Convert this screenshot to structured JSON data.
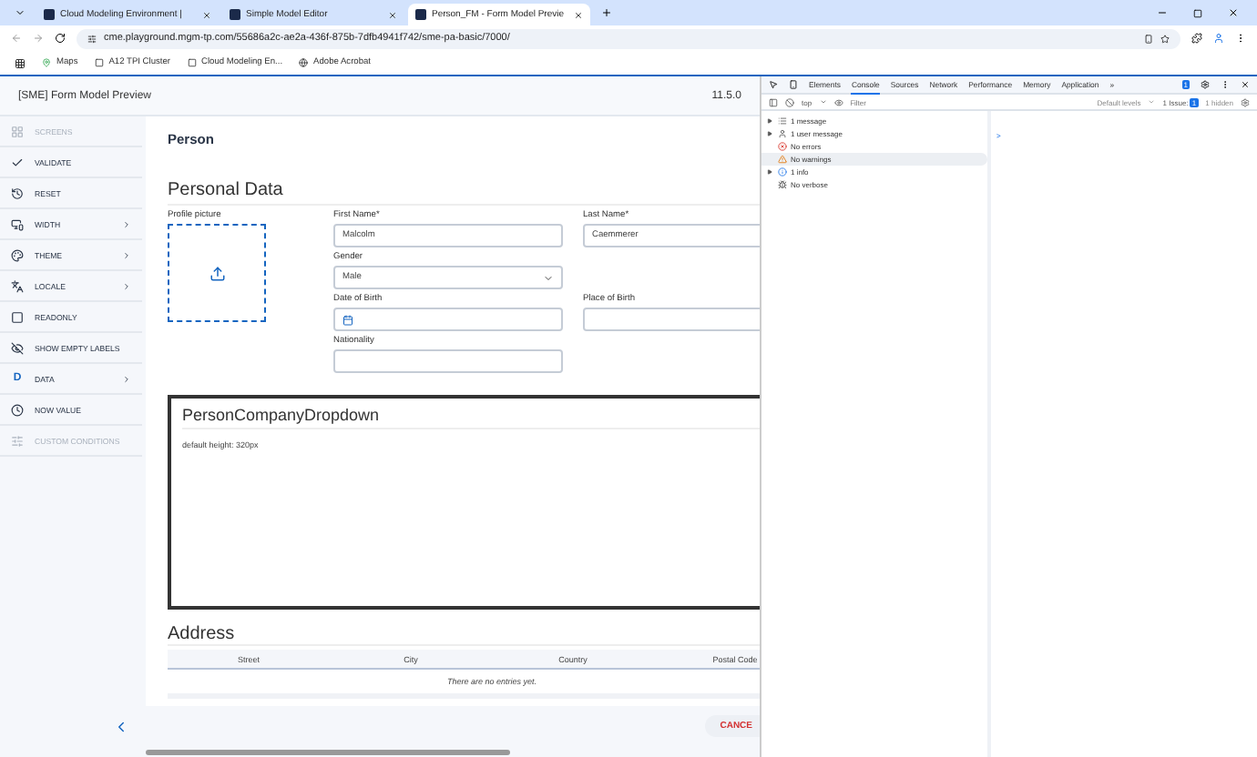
{
  "browser": {
    "tabs": [
      {
        "title": "Cloud Modeling Environment |",
        "selected": false
      },
      {
        "title": "Simple Model Editor",
        "selected": false
      },
      {
        "title": "Person_FM - Form Model Previe",
        "selected": true
      }
    ],
    "address": "cme.playground.mgm-tp.com/55686a2c-ae2a-436f-875b-7dfb4941f742/sme-pa-basic/7000/",
    "bookmarks": [
      "Maps",
      "A12 TPI Cluster",
      "Cloud Modeling En...",
      "Adobe Acrobat"
    ]
  },
  "app": {
    "title": "[SME] Form Model Preview",
    "version": "11.5.0"
  },
  "sidebar": {
    "items": [
      {
        "label": "SCREENS",
        "disabled": true,
        "submenu": false
      },
      {
        "label": "VALIDATE",
        "disabled": false,
        "submenu": false
      },
      {
        "label": "RESET",
        "disabled": false,
        "submenu": false
      },
      {
        "label": "WIDTH",
        "disabled": false,
        "submenu": true
      },
      {
        "label": "THEME",
        "disabled": false,
        "submenu": true
      },
      {
        "label": "LOCALE",
        "disabled": false,
        "submenu": true
      },
      {
        "label": "READONLY",
        "disabled": false,
        "submenu": false
      },
      {
        "label": "SHOW EMPTY LABELS",
        "disabled": false,
        "submenu": false
      },
      {
        "label": "DATA",
        "glyph": "D",
        "disabled": false,
        "submenu": true
      },
      {
        "label": "NOW VALUE",
        "disabled": false,
        "submenu": false
      },
      {
        "label": "CUSTOM CONDITIONS",
        "disabled": true,
        "submenu": false
      }
    ]
  },
  "form": {
    "title": "Person",
    "section": "Personal Data",
    "profile_label": "Profile picture",
    "rows": [
      [
        {
          "label": "First Name*",
          "kind": "text",
          "value": "Malcolm"
        },
        {
          "label": "Last Name*",
          "kind": "text",
          "value": "Caemmerer"
        }
      ],
      [
        {
          "label": "Gender",
          "kind": "select",
          "value": "Male"
        }
      ],
      [
        {
          "label": "Date of Birth",
          "kind": "date"
        },
        {
          "label": "Place of Birth",
          "kind": "text"
        }
      ],
      [
        {
          "label": "Nationality",
          "kind": "text"
        }
      ]
    ],
    "dropdown": {
      "title": "PersonCompanyDropdown",
      "note": "default height: 320px"
    },
    "address": {
      "title": "Address",
      "columns": [
        "Street",
        "City",
        "Country",
        "Postal Code"
      ],
      "empty": "There are no entries yet."
    },
    "cancel": "CANCE"
  },
  "devtools": {
    "tabs": [
      {
        "label": "Elements",
        "selected": false
      },
      {
        "label": "Console",
        "selected": true
      },
      {
        "label": "Sources",
        "selected": false
      },
      {
        "label": "Network",
        "selected": false
      },
      {
        "label": "Performance",
        "selected": false
      },
      {
        "label": "Memory",
        "selected": false
      },
      {
        "label": "Application",
        "selected": false
      }
    ],
    "more": "»",
    "badge": "1",
    "context": "top",
    "filter_placeholder": "Filter",
    "levels": "Default levels",
    "issues": "1 Issue:",
    "issues_count": "1",
    "hidden": "1 hidden",
    "groups": [
      {
        "label": "1 message",
        "kind": "list",
        "expandable": true,
        "selected": false
      },
      {
        "label": "1 user message",
        "kind": "user",
        "expandable": true,
        "selected": false
      },
      {
        "label": "No errors",
        "kind": "error",
        "expandable": false,
        "selected": false
      },
      {
        "label": "No warnings",
        "kind": "warning",
        "expandable": false,
        "selected": true
      },
      {
        "label": "1 info",
        "kind": "info",
        "expandable": true,
        "selected": false
      },
      {
        "label": "No verbose",
        "kind": "verbose",
        "expandable": false,
        "selected": false
      }
    ],
    "prompt": ">"
  }
}
